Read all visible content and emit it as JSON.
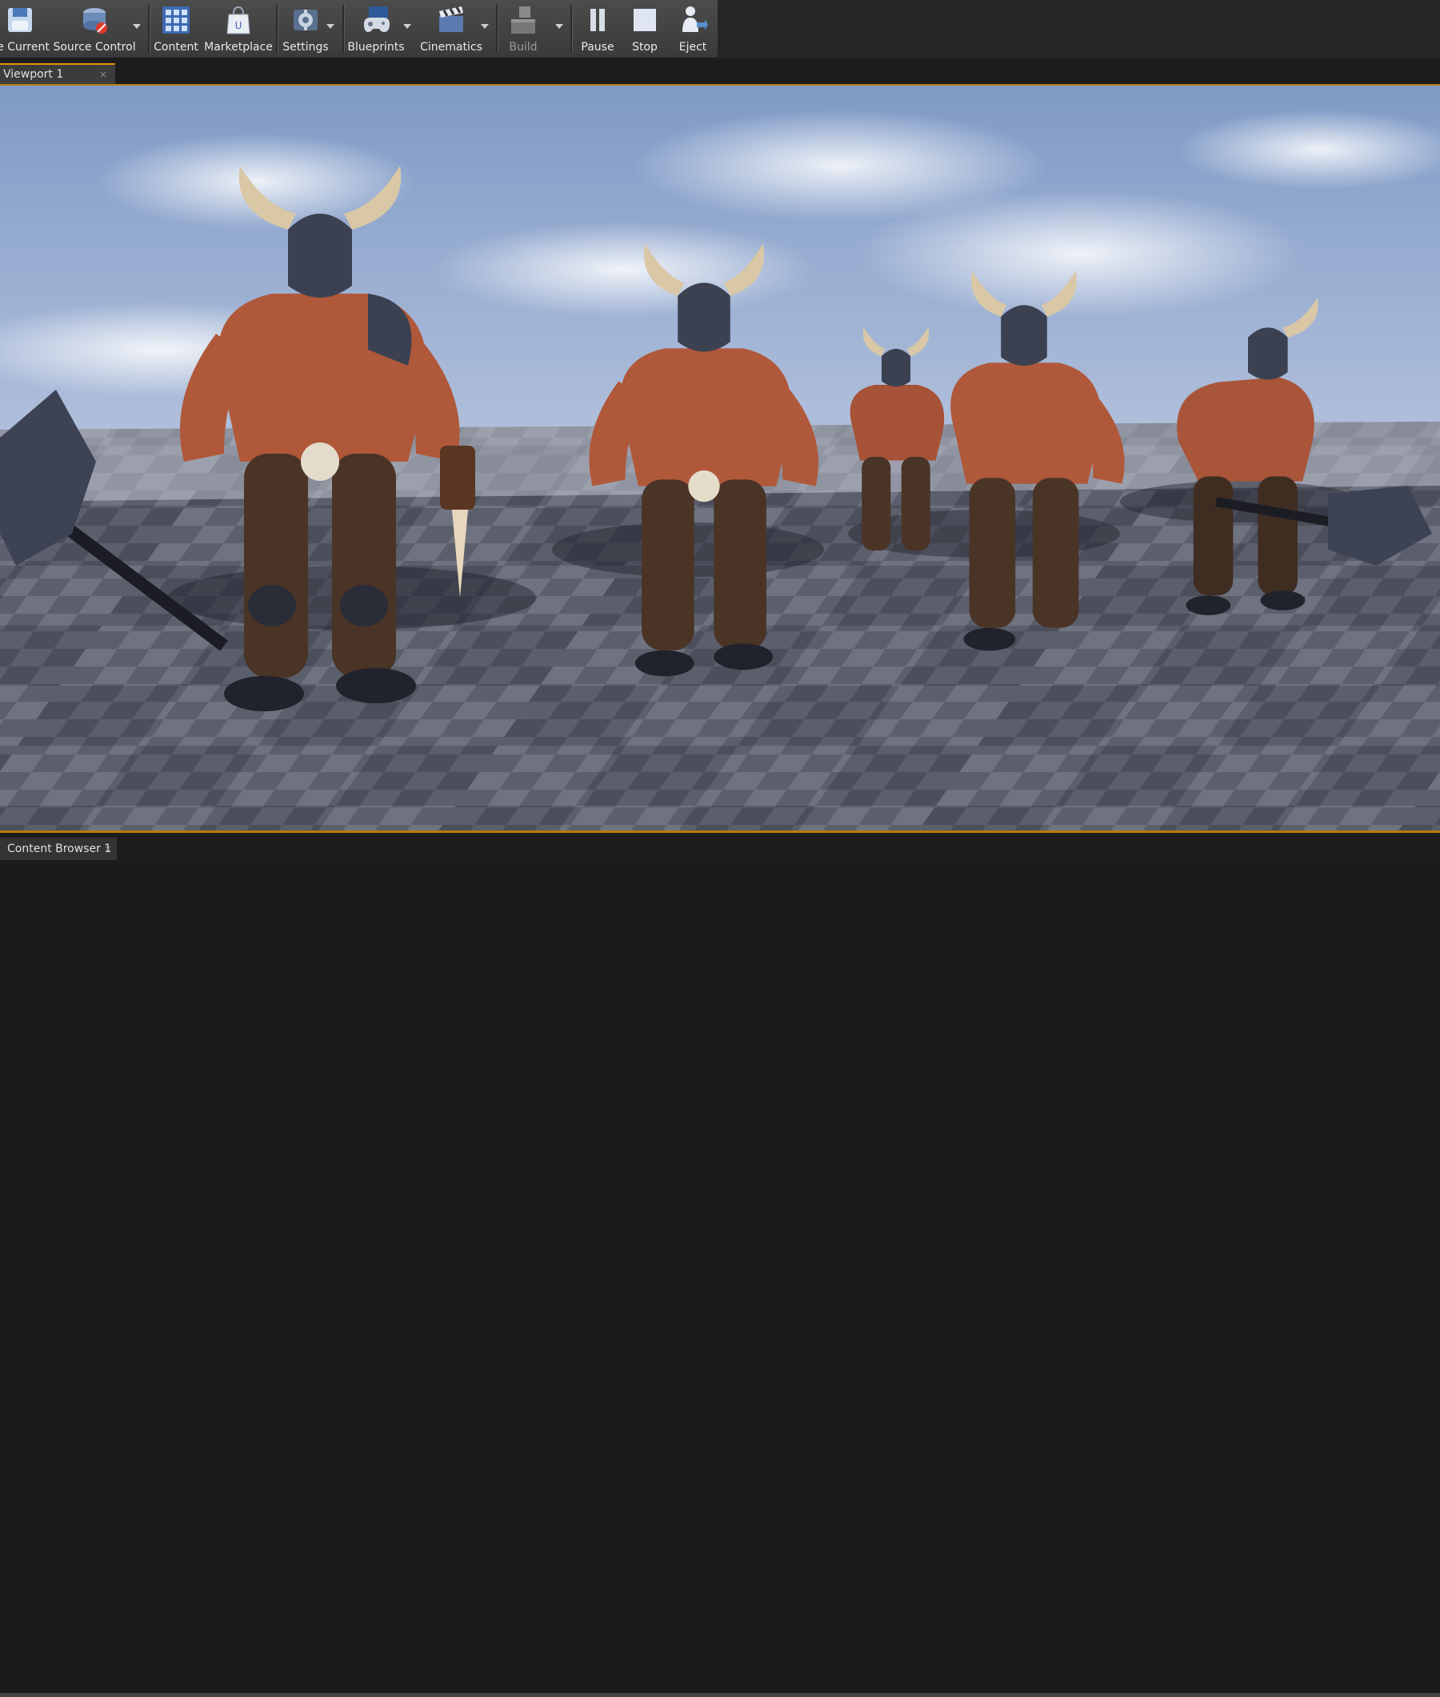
{
  "toolbar": {
    "buttons": [
      {
        "id": "save_current",
        "label": "e Current",
        "icon": "save-icon"
      },
      {
        "id": "source_control",
        "label": "Source Control",
        "icon": "source-control-icon"
      },
      {
        "id": "content",
        "label": "Content",
        "icon": "content-grid-icon"
      },
      {
        "id": "marketplace",
        "label": "Marketplace",
        "icon": "marketplace-bag-icon"
      },
      {
        "id": "settings",
        "label": "Settings",
        "icon": "settings-gear-icon"
      },
      {
        "id": "blueprints",
        "label": "Blueprints",
        "icon": "blueprints-gamepad-icon"
      },
      {
        "id": "cinematics",
        "label": "Cinematics",
        "icon": "clapperboard-icon"
      },
      {
        "id": "build",
        "label": "Build",
        "icon": "build-blocks-icon",
        "disabled": true
      },
      {
        "id": "pause",
        "label": "Pause",
        "icon": "pause-icon"
      },
      {
        "id": "stop",
        "label": "Stop",
        "icon": "stop-icon"
      },
      {
        "id": "eject",
        "label": "Eject",
        "icon": "eject-person-icon"
      }
    ]
  },
  "viewport_tab": {
    "label": "Viewport 1",
    "close": "×"
  },
  "content_browser_tab": {
    "label": "Content Browser 1",
    "close": "×"
  },
  "scene": {
    "description_icon": "level-viewport-scene",
    "colors": {
      "sky_top": "#7f9ac6",
      "sky_bottom": "#dfe3ef",
      "floor_light": "#7b7f8c",
      "floor_dark": "#555965",
      "skin": "#b35a3a",
      "armor": "#3c4152",
      "horn": "#d9c7a6"
    }
  }
}
